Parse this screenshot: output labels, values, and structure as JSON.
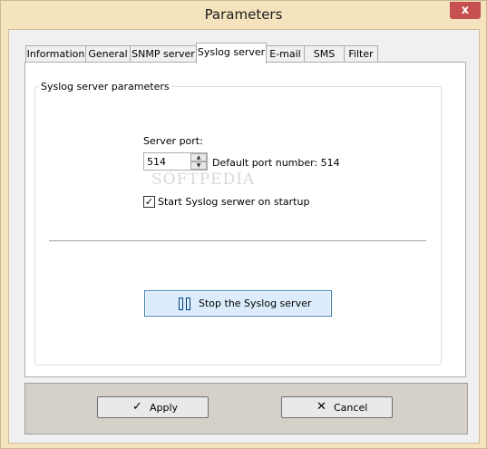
{
  "window": {
    "title": "Parameters",
    "close_glyph": "x"
  },
  "tabs": [
    {
      "label": "Information"
    },
    {
      "label": "General"
    },
    {
      "label": "SNMP server"
    },
    {
      "label": "Syslog server"
    },
    {
      "label": "E-mail"
    },
    {
      "label": "SMS"
    },
    {
      "label": "Filter"
    }
  ],
  "active_tab": "Syslog server",
  "syslog": {
    "group_title": "Syslog server parameters",
    "port_label": "Server port:",
    "port_value": "514",
    "default_port_text": "Default port number: 514",
    "startup_checkbox_label": "Start Syslog serwer on startup",
    "startup_checked": true,
    "stop_button_label": "Stop the Syslog server",
    "stop_icon": "pause-icon"
  },
  "footer": {
    "apply_label": "Apply",
    "apply_icon": "check-icon",
    "cancel_label": "Cancel",
    "cancel_icon": "x-icon"
  },
  "watermark": "SOFTPEDIA"
}
